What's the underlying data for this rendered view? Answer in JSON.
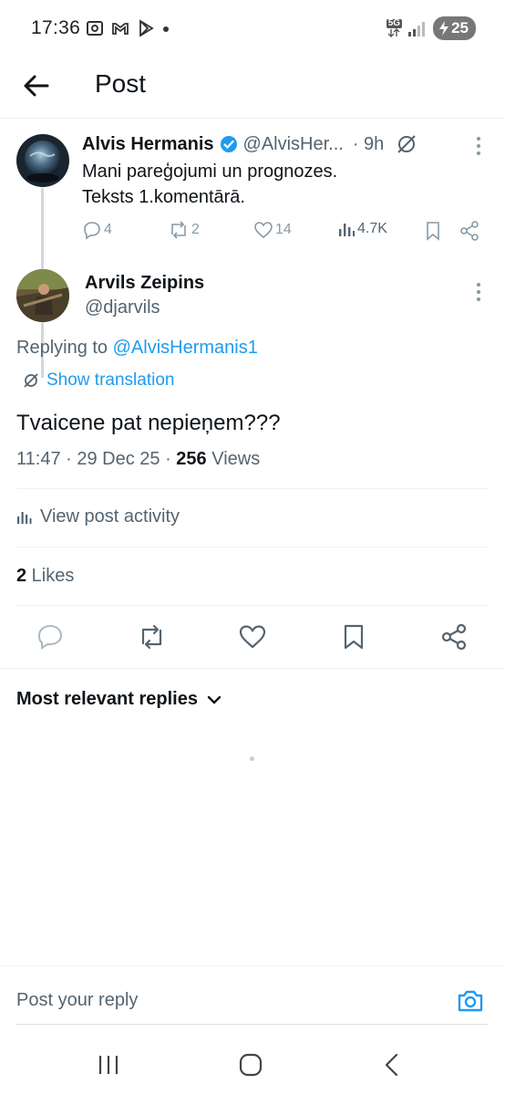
{
  "status_bar": {
    "time": "17:36",
    "network_label": "5G",
    "battery_level": "25"
  },
  "header": {
    "title": "Post"
  },
  "parent_post": {
    "author_name": "Alvis Hermanis",
    "handle": "@AlvisHer...",
    "time": "· 9h",
    "text_line1": "Mani pareģojumi un prognozes.",
    "text_line2": "Teksts 1.komentārā.",
    "replies": "4",
    "reposts": "2",
    "likes": "14",
    "views": "4.7K"
  },
  "reply_post": {
    "author_name": "Arvils Zeipins",
    "handle": "@djarvils",
    "replying_prefix": "Replying to ",
    "replying_mention": "@AlvisHermanis1",
    "show_translation": "Show translation",
    "text": "Tvaicene pat nepieņem???",
    "timestamp": "11:47 · 29 Dec 25 · ",
    "views_count": "256",
    "views_label": " Views",
    "view_activity": "View post activity",
    "likes_count": "2",
    "likes_label": " Likes"
  },
  "replies_sort": {
    "label": "Most relevant replies"
  },
  "compose": {
    "placeholder": "Post your reply"
  },
  "colors": {
    "accent": "#1d9bf0",
    "text_primary": "#0f1419",
    "text_secondary": "#536471",
    "divider": "#eff3f4"
  }
}
